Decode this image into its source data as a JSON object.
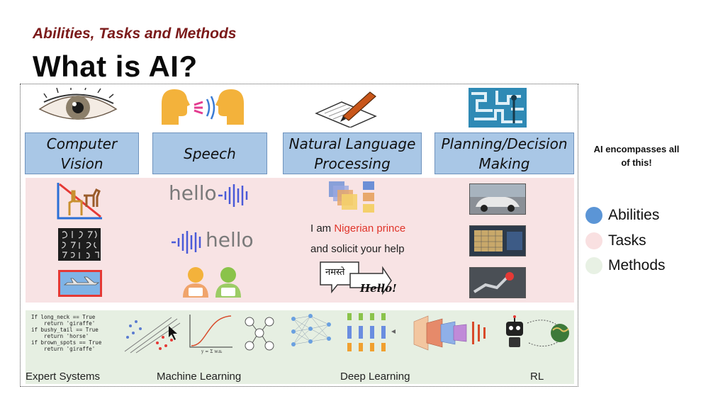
{
  "header": {
    "subtitle": "Abilities, Tasks and Methods",
    "title": "What is AI?"
  },
  "abilities": [
    {
      "line1": "Computer",
      "line2": "Vision",
      "icon": "eye-icon"
    },
    {
      "line1": "Speech",
      "line2": "",
      "icon": "speaking-heads-icon"
    },
    {
      "line1": "Natural Language",
      "line2": "Processing",
      "icon": "pen-writing-icon"
    },
    {
      "line1": "Planning/Decision",
      "line2": "Making",
      "icon": "maze-icon"
    }
  ],
  "tasks": {
    "speech_tts": "hello",
    "speech_asr": "hello",
    "nlp_line1_prefix": "I am ",
    "nlp_line1_highlight": "Nigerian prince",
    "nlp_line2": "and solicit your help",
    "translate_source": "नमस्ते",
    "translate_target": "Hello!"
  },
  "methods": {
    "code": "If long_neck == True\n    return 'giraffe'\nif bushy_tail == True\n    return 'horse'\nif brown_spots == True\n    return 'giraffe'",
    "labels": [
      "Expert Systems",
      "Machine Learning",
      "Deep Learning",
      "RL"
    ]
  },
  "side_note": {
    "line1": "AI encompasses all",
    "line2": "of this!"
  },
  "legend": [
    {
      "label": "Abilities",
      "color": "#5b95d6"
    },
    {
      "label": "Tasks",
      "color": "#f9e0e1"
    },
    {
      "label": "Methods",
      "color": "#e8f1e4"
    }
  ],
  "colors": {
    "subtitle": "#7b1a1a",
    "ability_box": "#a9c7e6",
    "tasks_band": "#f8e3e4",
    "methods_band": "#e6efe2",
    "highlight": "#e0342a"
  }
}
